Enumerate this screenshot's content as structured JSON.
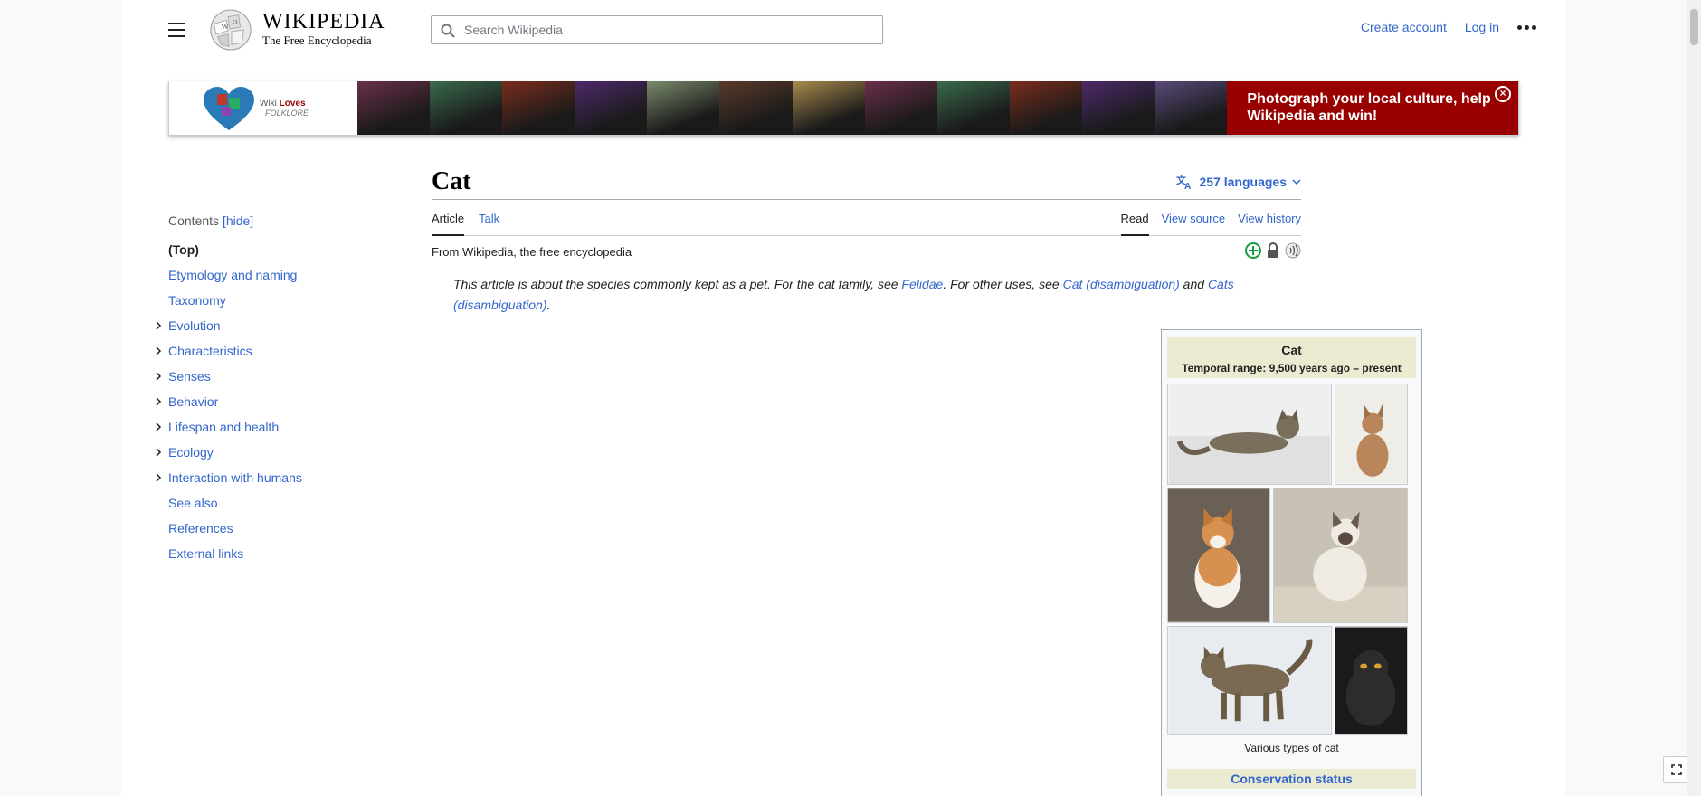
{
  "header": {
    "wordmark_title": "WIKIPEDIA",
    "wordmark_tagline": "The Free Encyclopedia",
    "search_placeholder": "Search Wikipedia",
    "create_account": "Create account",
    "log_in": "Log in"
  },
  "banner": {
    "logo_line1": "Wiki",
    "logo_line1b": "Loves",
    "logo_line2": "FOLKLORE",
    "cta": "Photograph your local culture, help Wikipedia and win!",
    "close": "×",
    "strip_colors": [
      "#6b2f4a",
      "#3a6a4d",
      "#7a2d1d",
      "#4d2a6b",
      "#7a8a6b",
      "#5a3a2a",
      "#a88a4d",
      "#6b2f4a",
      "#3a6a4d",
      "#7a2d1d",
      "#4d2a6b",
      "#5a4a7a"
    ]
  },
  "toc": {
    "title": "Contents",
    "hide": "[hide]",
    "items": [
      {
        "label": "(Top)",
        "expandable": false
      },
      {
        "label": "Etymology and naming",
        "expandable": false
      },
      {
        "label": "Taxonomy",
        "expandable": false
      },
      {
        "label": "Evolution",
        "expandable": true
      },
      {
        "label": "Characteristics",
        "expandable": true
      },
      {
        "label": "Senses",
        "expandable": true
      },
      {
        "label": "Behavior",
        "expandable": true
      },
      {
        "label": "Lifespan and health",
        "expandable": true
      },
      {
        "label": "Ecology",
        "expandable": true
      },
      {
        "label": "Interaction with humans",
        "expandable": true
      },
      {
        "label": "See also",
        "expandable": false
      },
      {
        "label": "References",
        "expandable": false
      },
      {
        "label": "External links",
        "expandable": false
      }
    ]
  },
  "article": {
    "title": "Cat",
    "languages": "257 languages",
    "tab_article": "Article",
    "tab_talk": "Talk",
    "tab_read": "Read",
    "tab_view_source": "View source",
    "tab_view_history": "View history",
    "from": "From Wikipedia, the free encyclopedia",
    "hatnote": {
      "pre": "This article is about the species commonly kept as a pet. For the cat family, see ",
      "link1": "Felidae",
      "mid": ". For other uses, see ",
      "link2": "Cat (disambiguation)",
      "and": " and ",
      "link3": "Cats (disambiguation)",
      "end": "."
    }
  },
  "infobox": {
    "name": "Cat",
    "range": "Temporal range: 9,500 years ago – present",
    "caption": "Various types of cat",
    "conservation": "Conservation status"
  }
}
